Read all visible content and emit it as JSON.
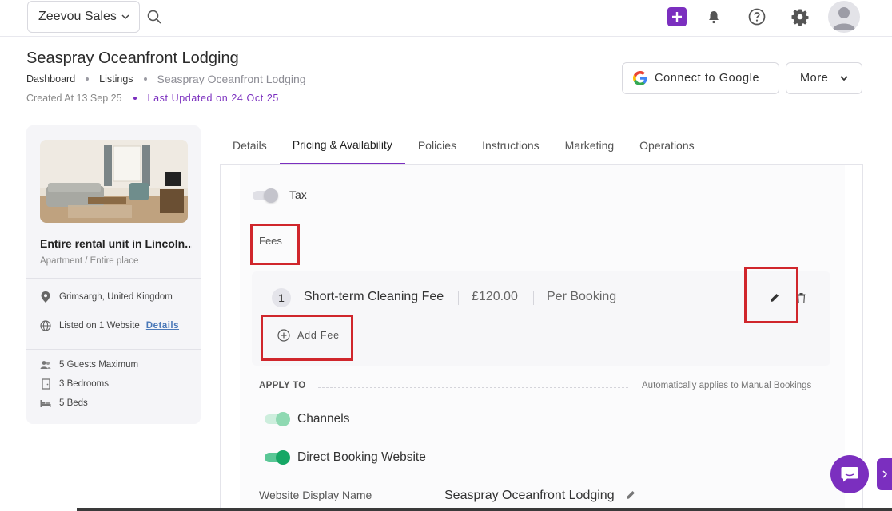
{
  "topbar": {
    "org_name": "Zeevou Sales",
    "icons": [
      "search-icon",
      "plus-icon",
      "bell-icon",
      "help-icon",
      "gear-icon",
      "user-avatar-icon"
    ],
    "accent": "#7b2fbf"
  },
  "header": {
    "title": "Seaspray Oceanfront Lodging",
    "breadcrumb": [
      "Dashboard",
      "Listings",
      "Seaspray Oceanfront Lodging"
    ],
    "created": "Created At 13 Sep 25",
    "updated": "Last Updated on 24 Oct 25",
    "connect_google_label": "Connect to Google",
    "more_label": "More"
  },
  "sidebar": {
    "listing_name": "Entire rental unit in Lincoln...",
    "listing_type": "Apartment / Entire place",
    "location": "Grimsargh, United Kingdom",
    "listed_on": "Listed on 1 Website",
    "details_link": "Details",
    "guests": "5 Guests Maximum",
    "bedrooms": "3 Bedrooms",
    "beds": "5 Beds"
  },
  "tabs": [
    {
      "label": "Details",
      "active": false
    },
    {
      "label": "Pricing & Availability",
      "active": true
    },
    {
      "label": "Policies",
      "active": false
    },
    {
      "label": "Instructions",
      "active": false
    },
    {
      "label": "Marketing",
      "active": false
    },
    {
      "label": "Operations",
      "active": false
    }
  ],
  "pricing": {
    "tax_label": "Tax",
    "tax_enabled": false,
    "fees_label": "Fees",
    "fees": [
      {
        "index": "1",
        "name": "Short-term Cleaning Fee",
        "amount": "£120.00",
        "unit": "Per Booking"
      }
    ],
    "add_fee_label": "Add Fee",
    "apply_to_label": "APPLY TO",
    "apply_note": "Automatically applies to Manual Bookings",
    "channels_label": "Channels",
    "channels_enabled": true,
    "direct_booking_label": "Direct Booking Website",
    "direct_booking_enabled": true,
    "website_display_name_label": "Website Display Name",
    "website_display_name_value": "Seaspray Oceanfront Lodging"
  },
  "colors": {
    "highlight_box": "#d0262c",
    "toggle_on": "#16a765"
  }
}
